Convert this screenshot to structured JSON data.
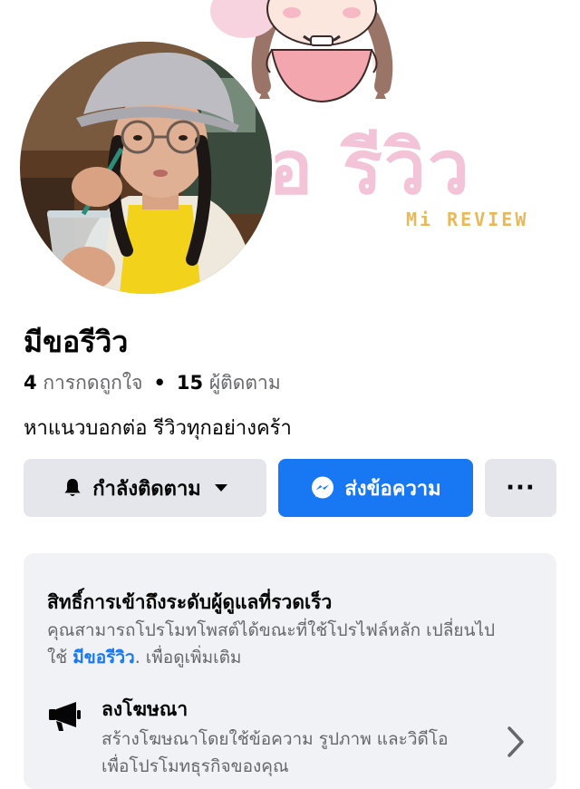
{
  "cover": {
    "title": "อ รีวิว",
    "subtitle": "Mi REVIEW"
  },
  "profile": {
    "name": "มีขอรีวิว",
    "likes_count": "4",
    "likes_label": "การกดถูกใจ",
    "separator": "•",
    "followers_count": "15",
    "followers_label": "ผู้ติดตาม",
    "bio": "หาแนวบอกต่อ รีวิวทุกอย่างคร้า"
  },
  "actions": {
    "following_label": "กำลังติดตาม",
    "message_label": "ส่งข้อความ",
    "more_label": "···",
    "following_icon": "bell-icon",
    "message_icon": "messenger-icon"
  },
  "admin_card": {
    "title": "สิทธิ์การเข้าถึงระดับผู้ดูแลที่รวดเร็ว",
    "desc_line1": "คุณสามารถโปรโมทโพสต์ได้ขณะที่ใช้โปรไฟล์หลัก เปลี่ยนไป",
    "desc_prefix": "ใช้",
    "desc_link": "มีขอรีวิว",
    "desc_suffix": ". เพื่อดูเพิ่มเติม",
    "promo": {
      "title": "ลงโฆษณา",
      "desc_line1": "สร้างโฆษณาโดยใช้ข้อความ รูปภาพ และวิดีโอ",
      "desc_line2": "เพื่อโปรโมทธุรกิจของคุณ",
      "icon": "megaphone-icon"
    }
  },
  "colors": {
    "primary": "#1877f2",
    "button_gray": "#e4e6eb",
    "card_bg": "#f0f2f5",
    "secondary_text": "#65676b",
    "cover_pink": "#f3c4d7",
    "cover_gold": "#e7b95a"
  }
}
